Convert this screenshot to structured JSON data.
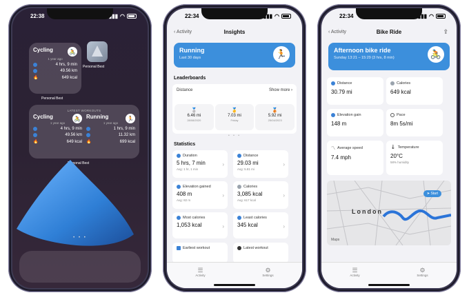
{
  "phone1": {
    "time": "22:38",
    "cycling_widget": {
      "title": "Cycling",
      "subtitle": "1 year ago",
      "duration": "4 hrs, 9 min",
      "distance": "49.56 km",
      "calories": "649 kcal",
      "footer": "Personal Best"
    },
    "app_icon_label": "Personal Best",
    "latest_widget": {
      "header": "LATEST WORKOUTS",
      "left": {
        "title": "Cycling",
        "subtitle": "1 year ago",
        "duration": "4 hrs, 9 min",
        "distance": "49.56 km",
        "calories": "649 kcal"
      },
      "right": {
        "title": "Running",
        "subtitle": "1 year ago",
        "duration": "1 hrs, 9 min",
        "distance": "11.32 km",
        "calories": "699 kcal"
      },
      "footer": "Personal Best"
    },
    "pager": "• • •"
  },
  "phone2": {
    "time": "22:34",
    "back_label": "Activity",
    "title": "Insights",
    "hero": {
      "title": "Running",
      "subtitle": "Last 30 days"
    },
    "leaderboards_heading": "Leaderboards",
    "distance_label": "Distance",
    "show_more": "Show more",
    "leaderboard": [
      {
        "medal": "🥈",
        "value": "6.46 mi",
        "date": "28/08/2020"
      },
      {
        "medal": "🥇",
        "value": "7.03 mi",
        "date": "Friday"
      },
      {
        "medal": "🥉",
        "value": "5.92 mi",
        "date": "25/04/2023"
      }
    ],
    "statistics_heading": "Statistics",
    "stats": [
      {
        "label": "Duration",
        "value": "5 hrs, 7 min",
        "avg": "Avg: 1 hr, 1 min"
      },
      {
        "label": "Distance",
        "value": "29.03 mi",
        "avg": "Avg: 5.81 mi"
      },
      {
        "label": "Elevation gained",
        "value": "408 m",
        "avg": "Avg: 82 m"
      },
      {
        "label": "Calories",
        "value": "3,085 kcal",
        "avg": "Avg: 617 kcal"
      },
      {
        "label": "Most calories",
        "value": "1,053 kcal",
        "avg": ""
      },
      {
        "label": "Least calories",
        "value": "345 kcal",
        "avg": ""
      },
      {
        "label": "Earliest workout",
        "value": "",
        "avg": ""
      },
      {
        "label": "Latest workout",
        "value": "",
        "avg": ""
      }
    ],
    "tabs": [
      {
        "label": "Activity"
      },
      {
        "label": "Settings"
      }
    ]
  },
  "phone3": {
    "time": "22:34",
    "back_label": "Activity",
    "title": "Bike Ride",
    "hero": {
      "title": "Afternoon bike ride",
      "subtitle": "Sunday 13:21 – 15:29 (3 hrs, 8 min)"
    },
    "metrics": [
      {
        "label": "Distance",
        "value": "30.79 mi",
        "sub": ""
      },
      {
        "label": "Calories",
        "value": "649 kcal",
        "sub": ""
      },
      {
        "label": "Elevation gain",
        "value": "148 m",
        "sub": ""
      },
      {
        "label": "Pace",
        "value": "8m 5s/mi",
        "sub": ""
      },
      {
        "label": "Average speed",
        "value": "7.4 mph",
        "sub": ""
      },
      {
        "label": "Temperature",
        "value": "20°C",
        "sub": "58% humidity"
      }
    ],
    "map": {
      "city": "London",
      "pin": "Start",
      "attribution": "Maps"
    },
    "tabs": [
      {
        "label": "Activity"
      },
      {
        "label": "Settings"
      }
    ]
  }
}
